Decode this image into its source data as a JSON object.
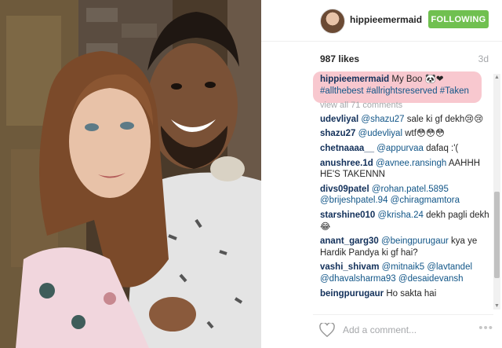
{
  "post": {
    "username": "hippieemermaid",
    "follow_button": "FOLLOWING",
    "likes": "987 likes",
    "time": "3d",
    "caption_user": "hippieemermaid",
    "caption_text": " My Boo 🐼❤",
    "caption_tags": "#allthebest #allrightsreserved #Taken",
    "view_all": "view all 71 comments",
    "add_comment_placeholder": "Add a comment...",
    "more_label": "•••"
  },
  "comments": [
    {
      "user": "udevliyal",
      "parts": [
        {
          "type": "mention",
          "text": " @shazu27"
        },
        {
          "type": "text",
          "text": " sale ki gf dekh😢😢"
        }
      ]
    },
    {
      "user": "shazu27",
      "parts": [
        {
          "type": "mention",
          "text": " @udevliyal"
        },
        {
          "type": "text",
          "text": " wtf😳😳😳"
        }
      ]
    },
    {
      "user": "chetnaaaa__",
      "parts": [
        {
          "type": "mention",
          "text": " @appurvaa"
        },
        {
          "type": "text",
          "text": " dafaq :'("
        }
      ]
    },
    {
      "user": "anushree.1d",
      "parts": [
        {
          "type": "mention",
          "text": " @avnee.ransingh"
        },
        {
          "type": "text",
          "text": " AAHHH HE'S TAKENNN"
        }
      ]
    },
    {
      "user": "divs09patel",
      "parts": [
        {
          "type": "mention",
          "text": " @rohan.patel.5895 @brijeshpatel.94 @chiragmamtora"
        }
      ]
    },
    {
      "user": "starshine010",
      "parts": [
        {
          "type": "mention",
          "text": " @krisha.24"
        },
        {
          "type": "text",
          "text": " dekh pagli dekh😂"
        }
      ]
    },
    {
      "user": "anant_garg30",
      "parts": [
        {
          "type": "mention",
          "text": " @beingpurugaur"
        },
        {
          "type": "text",
          "text": " kya ye Hardik Pandya ki gf hai?"
        }
      ]
    },
    {
      "user": "vashi_shivam",
      "parts": [
        {
          "type": "mention",
          "text": " @mitnaik5 @lavtandel @dhavalsharma93 @desaidevansh"
        }
      ]
    },
    {
      "user": "beingpurugaur",
      "parts": [
        {
          "type": "text",
          "text": " Ho sakta hai"
        }
      ]
    }
  ],
  "icons": {
    "heart": "heart-outline-icon",
    "scroll_up": "scroll-up-arrow-icon",
    "scroll_down": "scroll-down-arrow-icon"
  },
  "colors": {
    "follow_bg": "#70c050",
    "username": "#12305a",
    "mention": "#125688",
    "highlight": "#f8c8cf",
    "muted": "#a5a7aa"
  }
}
